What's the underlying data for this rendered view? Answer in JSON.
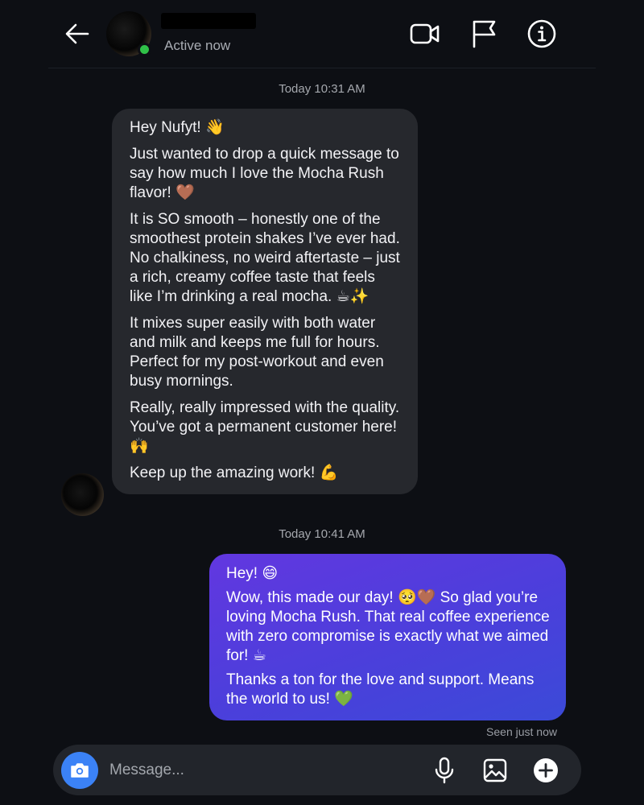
{
  "header": {
    "contact_name": "████████",
    "status": "Active now",
    "icons": [
      "back-arrow-icon",
      "video-call-icon",
      "flag-icon",
      "info-icon"
    ]
  },
  "thread": {
    "timestamp_1": "Today 10:31 AM",
    "incoming_message": {
      "paragraphs": [
        "Hey Nufyt! 👋",
        "Just wanted to drop a quick message to say how much I love the Mocha Rush flavor! 🤎",
        "It is SO smooth – honestly one of the smoothest protein shakes I’ve ever had. No chalkiness, no weird aftertaste – just a rich, creamy coffee taste that feels like I’m drinking a real mocha. ☕✨",
        "It mixes super easily with both water and milk and keeps me full for hours. Perfect for my post-workout and even busy mornings.",
        "Really, really impressed with the quality. You’ve got a permanent customer here! 🙌",
        "Keep up the amazing work! 💪"
      ]
    },
    "timestamp_2": "Today 10:41 AM",
    "outgoing_message": {
      "paragraphs": [
        "Hey! 😄",
        "Wow, this made our day! 🥺🤎 So glad you’re loving Mocha Rush. That real coffee experience with zero compromise is exactly what we aimed for! ☕",
        "Thanks a ton for the love and support. Means the world to us! 💚"
      ]
    },
    "seen_status": "Seen just now"
  },
  "composer": {
    "placeholder": "Message...",
    "icons": [
      "camera-icon",
      "microphone-icon",
      "gallery-icon",
      "plus-icon"
    ]
  },
  "colors": {
    "background": "#0d0f14",
    "incoming_bubble": "#26282d",
    "outgoing_bubble_gradient": [
      "#6237e0",
      "#3b4ad8"
    ],
    "online_indicator": "#30c148",
    "camera_button": "#3b82f6"
  }
}
